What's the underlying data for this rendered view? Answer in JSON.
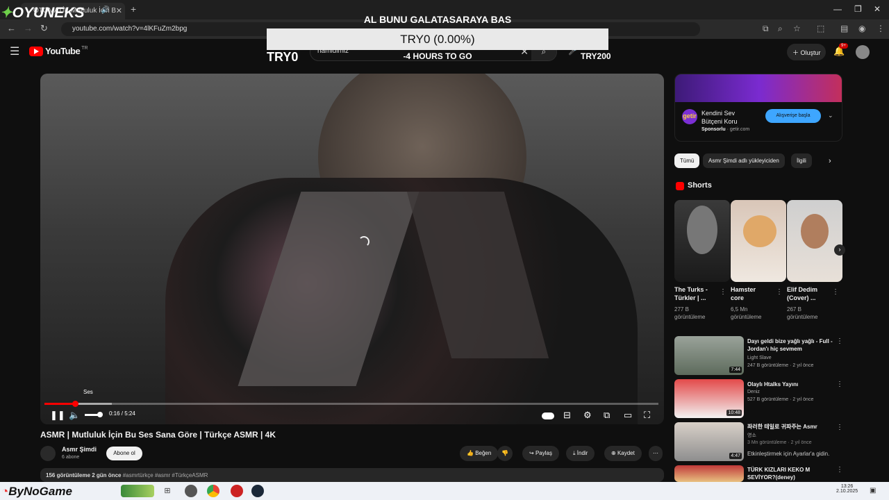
{
  "browser": {
    "tab_title": "OTOMATİK Mutluluk İçin B",
    "url": "youtube.com/watch?v=4lKFuZm2bpg"
  },
  "stream_brand": "OYUNEKS",
  "overlay": {
    "headline": "AL BUNU GALATASARAYA BAS",
    "box_text": "TRY0 (0.00%)",
    "left_amount": "TRY0",
    "countdown": "-4 HOURS TO GO",
    "right_amount": "TRY200"
  },
  "youtube": {
    "logo": "YouTube",
    "logo_suffix": "TR",
    "search_query": "hamidimiz",
    "create_label": "Oluştur",
    "notification_count": "9+"
  },
  "player": {
    "tooltip": "Ses",
    "time": "0:16 / 5:24",
    "progress": 0.05,
    "buffered": 0.11,
    "volume": 0.6
  },
  "video": {
    "title": "ASMR | Mutluluk İçin Bu Ses Sana Göre | Türkçe ASMR | 4K",
    "channel": "Asmr Şimdi",
    "subscribers": "6 abone",
    "subscribe_label": "Abone ol",
    "like_label": "Beğen",
    "share_label": "Paylaş",
    "download_label": "İndir",
    "save_label": "Kaydet",
    "desc_stats": "156 görüntüleme  2 gün önce",
    "desc_tags": "#asmrtürkçe #asmr #TürkçeASMR"
  },
  "ad": {
    "title_line1": "Kendini Sev",
    "title_line2": "Bütçeni Koru",
    "sponsor_label": "Sponsorlu",
    "sponsor_domain": "· getir.com",
    "logo_text": "getir",
    "button_label": "Alışverişe başla"
  },
  "chips": [
    "Tümü",
    "Asmr Şimdi adlı yükleyiciden",
    "İlgili"
  ],
  "shorts": {
    "heading": "Shorts",
    "items": [
      {
        "title1": "The Turks -",
        "title2": "Türkler | ...",
        "views": "277 B",
        "views2": "görüntüleme"
      },
      {
        "title1": "Hamster",
        "title2": "core",
        "views": "6,5 Mn",
        "views2": "görüntüleme"
      },
      {
        "title1": "Elif Dedim",
        "title2": "(Cover) ...",
        "views": "267 B",
        "views2": "görüntüleme"
      }
    ]
  },
  "related": [
    {
      "title": "Dayı geldi bize yağlı yağlı - Full - Jordan'ı hiç sevmem",
      "channel": "Light Slave",
      "meta": "247 B görüntüleme · 2 yıl önce",
      "duration": "7:44"
    },
    {
      "title": "Olaylı Htalks Yayını",
      "channel": "Deniz",
      "meta": "527 B görüntüleme · 2 yıl önce",
      "duration": "10:48"
    },
    {
      "title": "좌러한 테일로 귀파주는 Asmr",
      "channel": "영소",
      "meta": "3 Mn görüntüleme · 2 yıl önce",
      "duration": "4:47"
    },
    {
      "title": "TÜRK KIZLARI KEKO M SEVİYOR?(deney)",
      "channel": "",
      "meta": "",
      "duration": ""
    }
  ],
  "activation_watermark": "Etkinleştirmek için Ayarlar'a gidin.",
  "taskbar": {
    "brand": "ByNoGame",
    "time": "13:26",
    "date": "2.10.2025"
  }
}
